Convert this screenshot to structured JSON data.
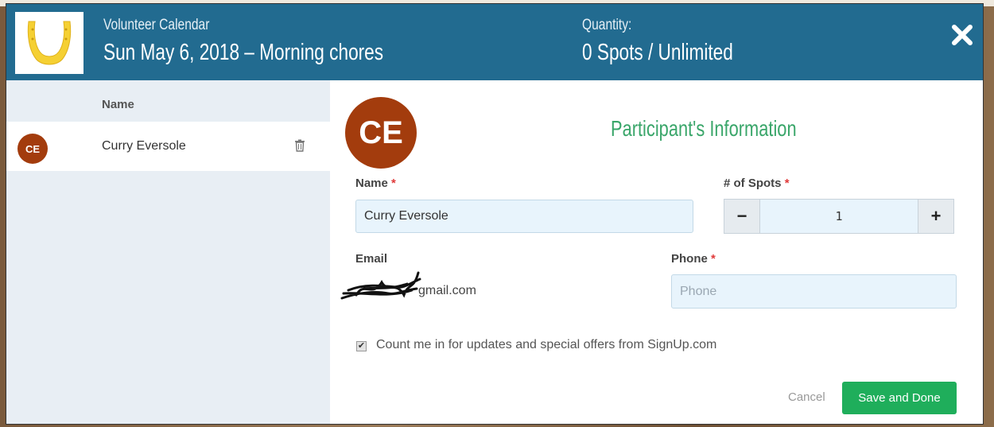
{
  "header": {
    "calendar_title": "Volunteer Calendar",
    "event": "Sun May 6, 2018 – Morning chores",
    "quantity_label": "Quantity:",
    "quantity_value": "0 Spots / Unlimited",
    "close_icon": "close-icon",
    "logo_icon": "horseshoe-icon"
  },
  "sidebar": {
    "column_header": "Name",
    "rows": [
      {
        "initials": "CE",
        "name": "Curry Eversole",
        "action_icon": "trash-icon"
      }
    ]
  },
  "form": {
    "avatar_initials": "CE",
    "section_title": "Participant's Information",
    "name_label": "Name",
    "name_value": "Curry Eversole",
    "spots_label": "# of Spots",
    "spots_value": "1",
    "minus": "−",
    "plus": "+",
    "email_label": "Email",
    "email_value": "gmail.com",
    "phone_label": "Phone",
    "phone_placeholder": "Phone",
    "required_marker": "*",
    "updates_checkbox_checked": true,
    "updates_label": "Count me in for updates and special offers from SignUp.com",
    "cancel_label": "Cancel",
    "save_label": "Save and Done"
  },
  "colors": {
    "header_bg": "#226b90",
    "avatar_bg": "#a33c0d",
    "title_green": "#3aa66a",
    "save_green": "#1fae5b",
    "required_red": "#e03a3a"
  }
}
